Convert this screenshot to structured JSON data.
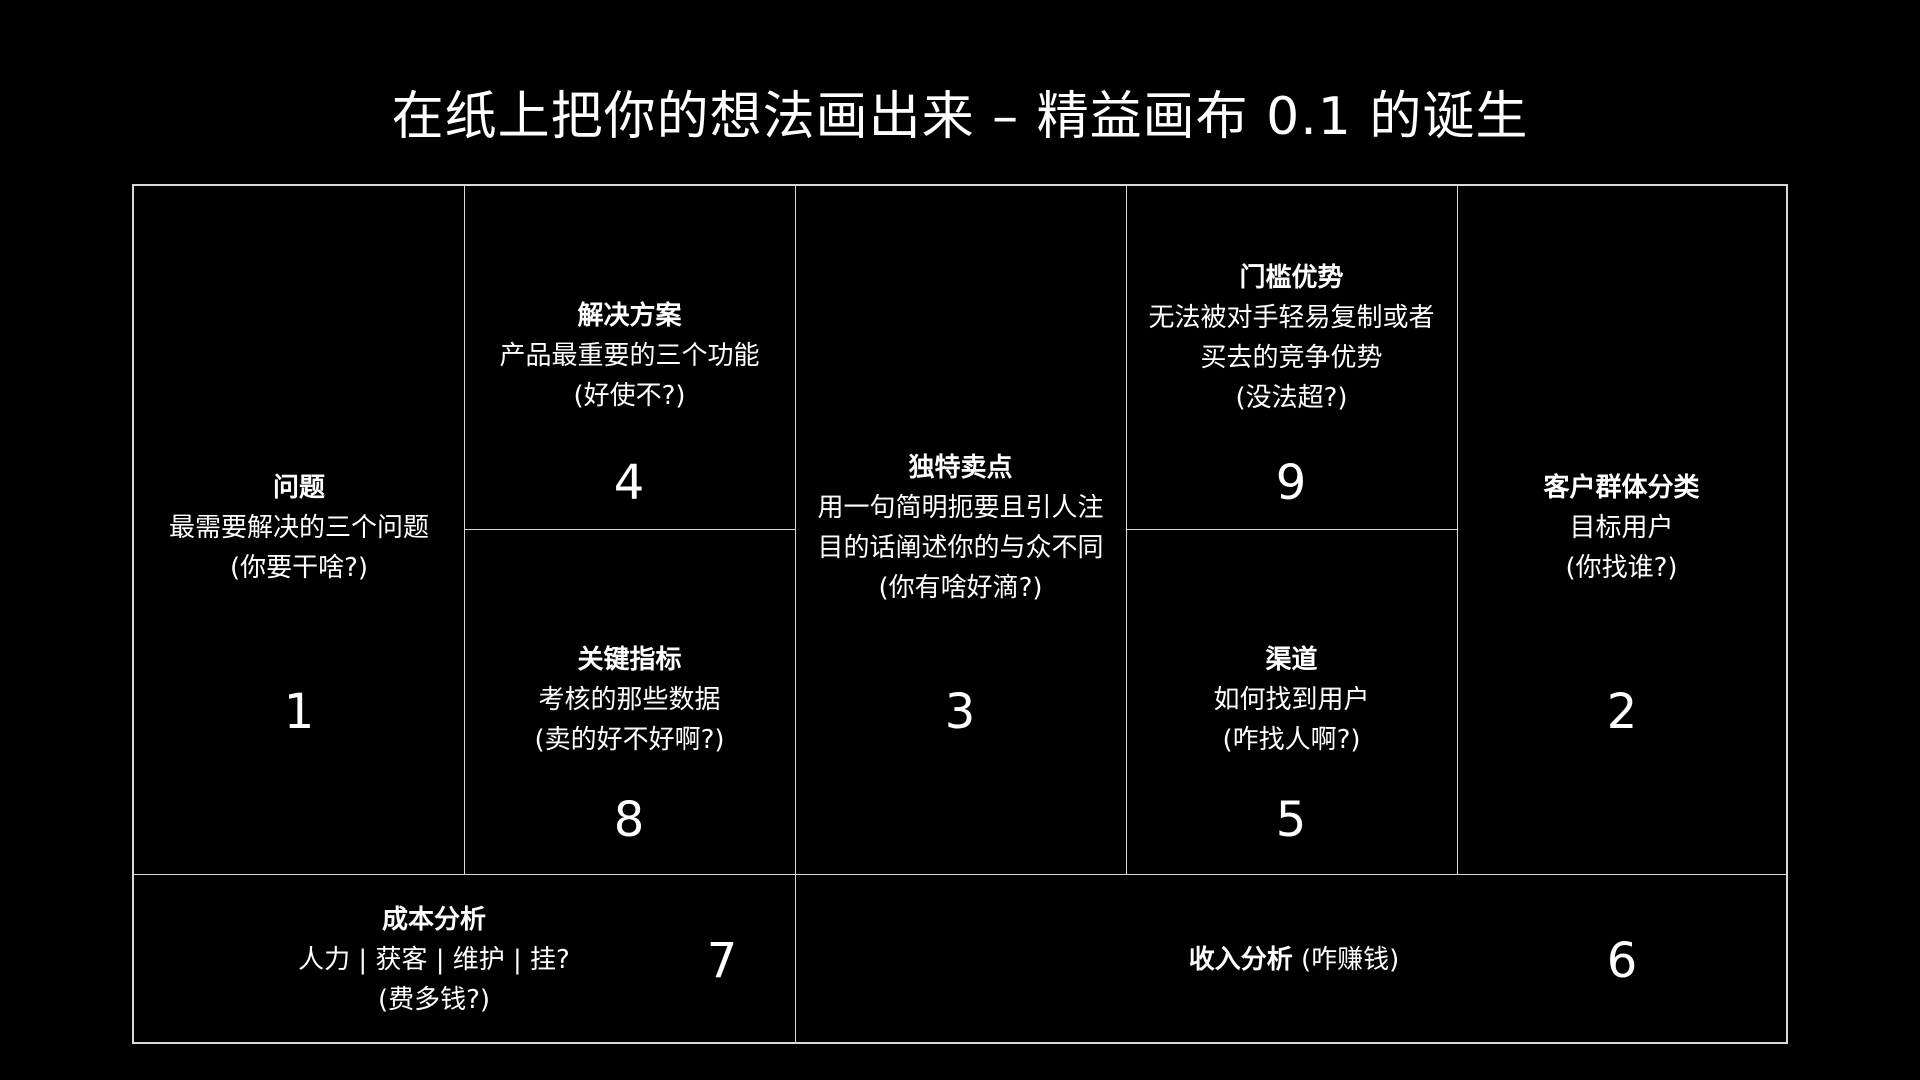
{
  "title": "在纸上把你的想法画出来 – 精益画布 0.1 的诞生",
  "cells": {
    "problem": {
      "heading": "问题",
      "line1": "最需要解决的三个问题",
      "line2": "(你要干啥?)",
      "number": "1"
    },
    "solution": {
      "heading": "解决方案",
      "line1": "产品最重要的三个功能",
      "line2": "(好使不?)",
      "number": "4"
    },
    "key_metrics": {
      "heading": "关键指标",
      "line1": "考核的那些数据",
      "line2": "(卖的好不好啊?)",
      "number": "8"
    },
    "uvp": {
      "heading": "独特卖点",
      "line1": "用一句简明扼要且引人注",
      "line2": "目的话阐述你的与众不同",
      "line3": "(你有啥好滴?)",
      "number": "3"
    },
    "unfair_advantage": {
      "heading": "门槛优势",
      "line1": "无法被对手轻易复制或者",
      "line2": "买去的竞争优势",
      "line3": "(没法超?)",
      "number": "9"
    },
    "channels": {
      "heading": "渠道",
      "line1": "如何找到用户",
      "line2": "(咋找人啊?)",
      "number": "5"
    },
    "customer_segments": {
      "heading": "客户群体分类",
      "line1": "目标用户",
      "line2": "(你找谁?)",
      "number": "2"
    },
    "cost_structure": {
      "heading": "成本分析",
      "line1": "人力 | 获客 | 维护 | 挂?",
      "line2": "(费多钱?)",
      "number": "7"
    },
    "revenue_streams": {
      "heading": "收入分析",
      "note": "(咋赚钱)",
      "number": "6"
    }
  }
}
